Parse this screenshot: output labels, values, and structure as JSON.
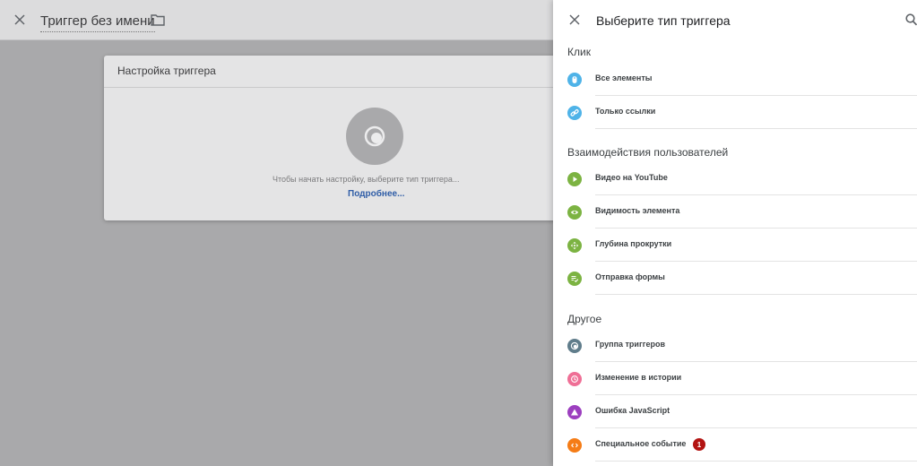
{
  "background": {
    "title": "Триггер без имени",
    "card": {
      "title": "Настройка триггера",
      "hint": "Чтобы начать настройку, выберите тип триггера...",
      "more_link": "Подробнее..."
    }
  },
  "panel": {
    "title": "Выберите тип триггера",
    "sections": [
      {
        "title": "Клик",
        "items": [
          {
            "label": "Все элементы",
            "icon": "mouse-icon",
            "color": "#4fb3e8"
          },
          {
            "label": "Только ссылки",
            "icon": "link-icon",
            "color": "#4fb3e8"
          }
        ]
      },
      {
        "title": "Взаимодействия пользователей",
        "items": [
          {
            "label": "Видео на YouTube",
            "icon": "play-icon",
            "color": "#7cb342"
          },
          {
            "label": "Видимость элемента",
            "icon": "eye-icon",
            "color": "#7cb342"
          },
          {
            "label": "Глубина прокрутки",
            "icon": "scroll-icon",
            "color": "#7cb342"
          },
          {
            "label": "Отправка формы",
            "icon": "form-icon",
            "color": "#7cb342"
          }
        ]
      },
      {
        "title": "Другое",
        "items": [
          {
            "label": "Группа триггеров",
            "icon": "trigger-group-icon",
            "color": "#607d8b"
          },
          {
            "label": "Изменение в истории",
            "icon": "history-icon",
            "color": "#ef6f96"
          },
          {
            "label": "Ошибка JavaScript",
            "icon": "warning-icon",
            "color": "#9c3fbf"
          },
          {
            "label": "Специальное событие",
            "icon": "code-icon",
            "color": "#f57c16",
            "badge": "1"
          }
        ]
      }
    ]
  }
}
